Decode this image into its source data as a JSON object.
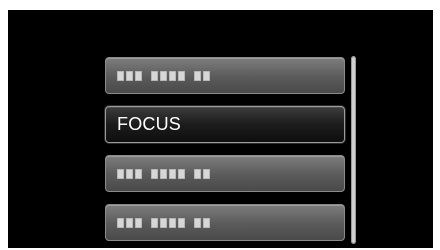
{
  "menu": {
    "items": [
      {
        "label": "",
        "state": "obscured"
      },
      {
        "label": "FOCUS",
        "state": "selected"
      },
      {
        "label": "",
        "state": "obscured"
      },
      {
        "label": "",
        "state": "obscured"
      }
    ]
  },
  "scrollbar": {
    "position": 0
  }
}
